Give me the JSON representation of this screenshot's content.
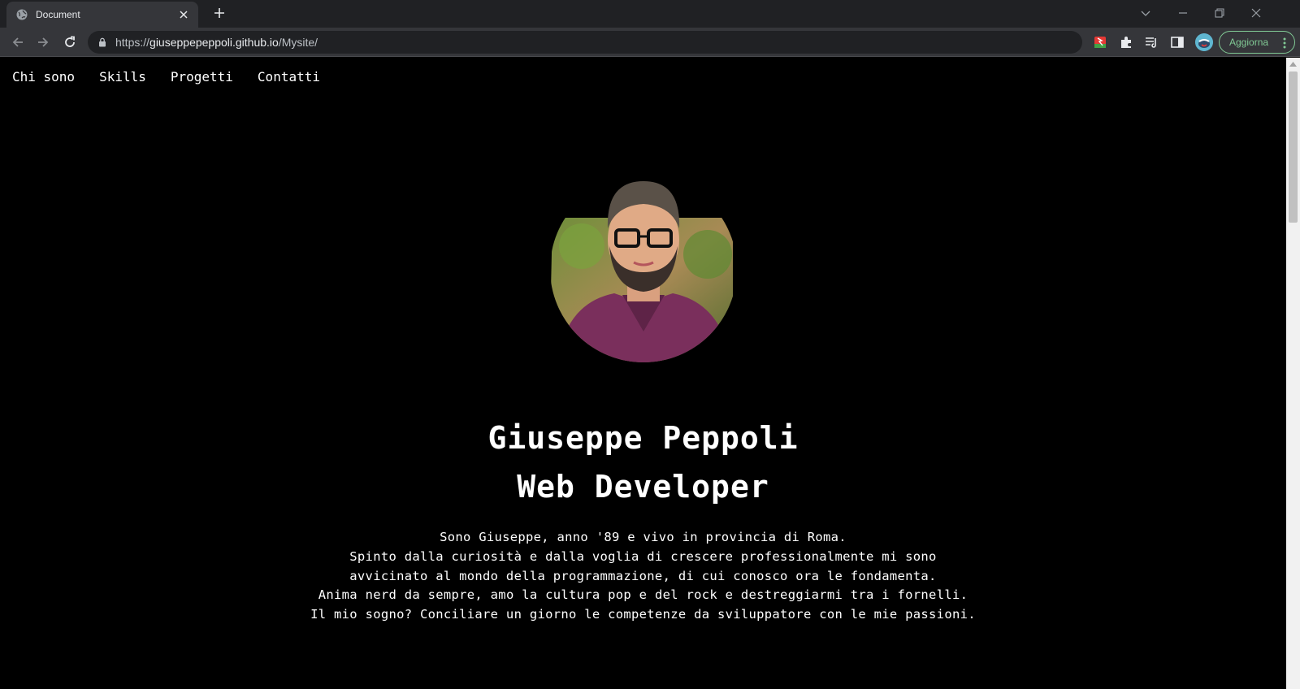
{
  "browser": {
    "tab_title": "Document",
    "url_scheme": "https://",
    "url_host": "giuseppepeppoli.github.io",
    "url_path": "/Mysite/",
    "update_label": "Aggiorna"
  },
  "nav": {
    "items": [
      "Chi sono",
      "Skills",
      "Progetti",
      "Contatti"
    ]
  },
  "hero": {
    "name": "Giuseppe Peppoli",
    "role": "Web Developer"
  },
  "bio": [
    "Sono Giuseppe, anno '89 e vivo in provincia di Roma.",
    "Spinto dalla curiosità e dalla voglia di crescere professionalmente mi sono",
    "avvicinato al mondo della programmazione, di cui conosco ora le fondamenta.",
    "Anima nerd da sempre, amo la cultura pop e del rock e destreggiarmi tra i fornelli.",
    "Il mio sogno? Conciliare un giorno le competenze da sviluppatore con le mie passioni."
  ],
  "colors": {
    "page_background": "#000000",
    "text": "#ffffff",
    "update_accent": "#81c995"
  }
}
